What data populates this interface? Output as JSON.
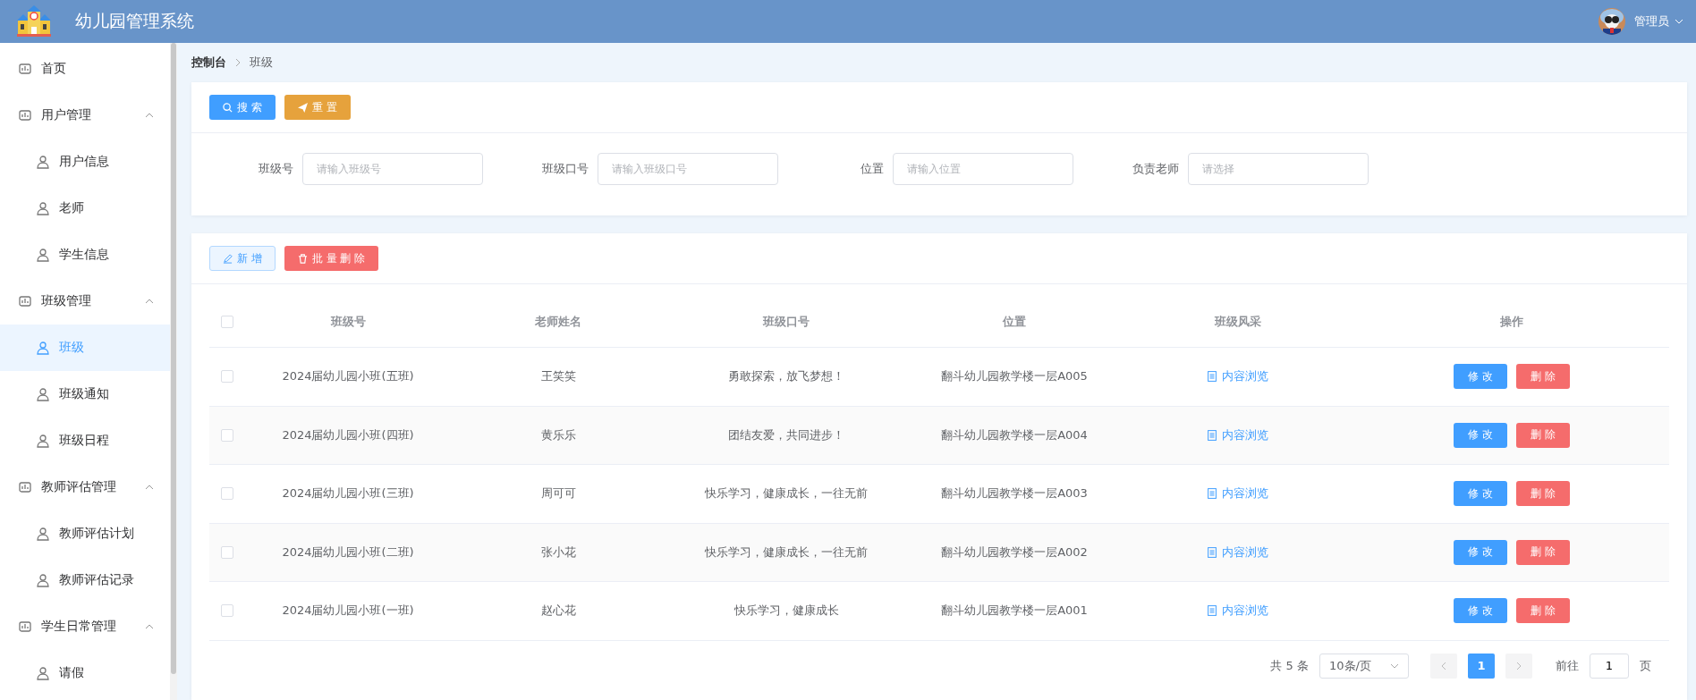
{
  "header": {
    "title": "幼儿园管理系统",
    "user": "管理员"
  },
  "sidebar": {
    "items": [
      {
        "label": "首页",
        "selected": false
      },
      {
        "label": "用户管理",
        "expanded": true,
        "children": [
          {
            "label": "用户信息",
            "selected": false
          },
          {
            "label": "老师",
            "selected": false
          },
          {
            "label": "学生信息",
            "selected": false
          }
        ]
      },
      {
        "label": "班级管理",
        "expanded": true,
        "children": [
          {
            "label": "班级",
            "selected": true
          },
          {
            "label": "班级通知",
            "selected": false
          },
          {
            "label": "班级日程",
            "selected": false
          }
        ]
      },
      {
        "label": "教师评估管理",
        "expanded": true,
        "children": [
          {
            "label": "教师评估计划",
            "selected": false
          },
          {
            "label": "教师评估记录",
            "selected": false
          }
        ]
      },
      {
        "label": "学生日常管理",
        "expanded": true,
        "children": [
          {
            "label": "请假",
            "selected": false
          }
        ]
      }
    ]
  },
  "breadcrumb": [
    "控制台",
    "班级"
  ],
  "search_buttons": [
    "搜 索",
    "重 置"
  ],
  "filters": [
    {
      "label": "班级号",
      "placeholder": "请输入班级号"
    },
    {
      "label": "班级口号",
      "placeholder": "请输入班级口号"
    },
    {
      "label": "位置",
      "placeholder": "请输入位置"
    },
    {
      "label": "负责老师",
      "placeholder": "请选择"
    }
  ],
  "toolbar_buttons": [
    "新 增",
    "批 量 删 除"
  ],
  "table": {
    "header_checked": false,
    "columns": [
      "班级号",
      "老师姓名",
      "班级口号",
      "位置",
      "班级风采",
      "操作"
    ],
    "rows": [
      {
        "checked": false,
        "class_no": "2024届幼儿园小班(五班)",
        "teacher": "王笑笑",
        "slogan": "勇敢探索，放飞梦想！",
        "location": "翻斗幼儿园教学楼一层A005",
        "view": "内容浏览",
        "edit": "修 改",
        "delete": "删 除"
      },
      {
        "checked": false,
        "class_no": "2024届幼儿园小班(四班)",
        "teacher": "黄乐乐",
        "slogan": "团结友爱，共同进步！",
        "location": "翻斗幼儿园教学楼一层A004",
        "view": "内容浏览",
        "edit": "修 改",
        "delete": "删 除"
      },
      {
        "checked": false,
        "class_no": "2024届幼儿园小班(三班)",
        "teacher": "周可可",
        "slogan": "快乐学习，健康成长，一往无前",
        "location": "翻斗幼儿园教学楼一层A003",
        "view": "内容浏览",
        "edit": "修 改",
        "delete": "删 除"
      },
      {
        "checked": false,
        "class_no": "2024届幼儿园小班(二班)",
        "teacher": "张小花",
        "slogan": "快乐学习，健康成长，一往无前",
        "location": "翻斗幼儿园教学楼一层A002",
        "view": "内容浏览",
        "edit": "修 改",
        "delete": "删 除"
      },
      {
        "checked": false,
        "class_no": "2024届幼儿园小班(一班)",
        "teacher": "赵心花",
        "slogan": "快乐学习，健康成长",
        "location": "翻斗幼儿园教学楼一层A001",
        "view": "内容浏览",
        "edit": "修 改",
        "delete": "删 除"
      }
    ]
  },
  "pagination": {
    "total": "共 5 条",
    "page_size": "10条/页",
    "pages": [
      {
        "label": "1",
        "selected": true
      }
    ],
    "goto_label": "前往",
    "goto_value": "1",
    "goto_suffix": "页"
  }
}
